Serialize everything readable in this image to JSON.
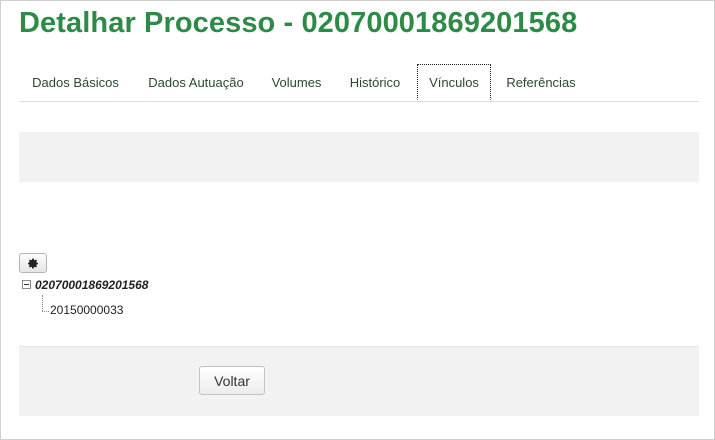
{
  "page": {
    "title": "Detalhar Processo - 02070001869201568",
    "title_color": "#2e8b47"
  },
  "tabs": [
    {
      "label": "Dados Básicos",
      "active": false
    },
    {
      "label": "Dados Autuação",
      "active": false
    },
    {
      "label": "Volumes",
      "active": false
    },
    {
      "label": "Histórico",
      "active": false
    },
    {
      "label": "Vínculos",
      "active": true
    },
    {
      "label": "Referências",
      "active": false
    }
  ],
  "toolbar": {
    "settings_icon": "gear-icon"
  },
  "tree": {
    "root": {
      "label": "02070001869201568",
      "expanded": true,
      "toggle_icon": "minus-box-icon"
    },
    "children": [
      {
        "label": "20150000033"
      }
    ]
  },
  "footer": {
    "back_label": "Voltar"
  }
}
